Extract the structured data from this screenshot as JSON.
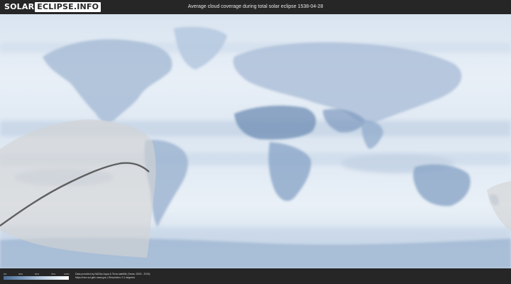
{
  "header": {
    "logo_part1": "SOLAR",
    "logo_part2": "ECLIPSE.INFO",
    "title": "Average cloud coverage during total solar eclipse 1538-04-28"
  },
  "map": {
    "description_colors": {
      "cloud_dark": "#5b7aa3",
      "cloud_light": "#eef3f9",
      "path_shade": "#d3d3d3",
      "central_line": "#4a4a4a"
    }
  },
  "legend": {
    "ticks": [
      "0%",
      "25%",
      "50%",
      "75%",
      "100%"
    ]
  },
  "footer": {
    "credit_line1": "Data provided by NASAs Aqua & Terra satellite (Years: 2000 - 2019)",
    "credit_line2": "https://neo.sci.gsfc.nasa.gov | Resolution: 0.1 degrees"
  }
}
